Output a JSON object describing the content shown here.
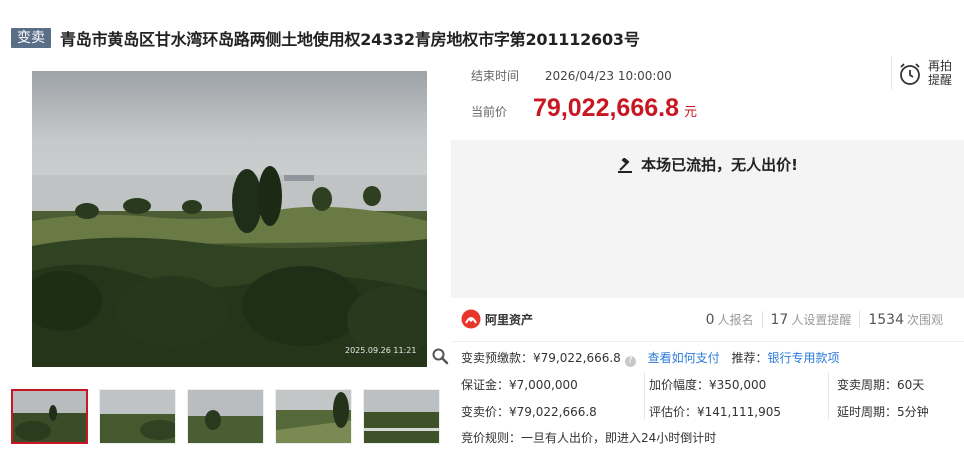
{
  "header": {
    "badge": "变卖",
    "title": "青岛市黄岛区甘水湾环岛路两侧土地使用权24332青房地权市字第201112603号"
  },
  "photo": {
    "timestamp": "2025.09.26 11:21"
  },
  "price": {
    "end_label": "结束时间",
    "end_value": "2026/04/23 10:00:00",
    "remind_label_1": "再拍",
    "remind_label_2": "提醒",
    "current_label": "当前价",
    "current_value": "79,022,666.8",
    "current_unit": "元"
  },
  "status": {
    "text": "本场已流拍，无人出价!"
  },
  "platform": {
    "name": "阿里资产",
    "signups": "0",
    "signups_label": "人报名",
    "reminders": "17",
    "reminders_label": "人设置提醒",
    "views": "1534",
    "views_label": "次围观"
  },
  "info": {
    "deposit_pre_label": "变卖预缴款：",
    "deposit_pre_value": "¥79,022,666.8",
    "how_to_pay": "查看如何支付",
    "recommend_label": "推荐：",
    "bank_loan": "银行专用款项",
    "deposit_label": "保证金：",
    "deposit_value": "¥7,000,000",
    "increment_label": "加价幅度：",
    "increment_value": "¥350,000",
    "cycle_label": "变卖周期：",
    "cycle_value": "60天",
    "sale_price_label": "变卖价：",
    "sale_price_value": "¥79,022,666.8",
    "appraisal_label": "评估价：",
    "appraisal_value": "¥141,111,905",
    "delay_label": "延时周期：",
    "delay_value": "5分钟",
    "rule_label": "竞价规则：",
    "rule_value": "一旦有人出价，即进入24小时倒计时"
  },
  "colors": {
    "accent_red": "#c81623",
    "badge_bg": "#5a6e88",
    "link_blue": "#2d7bd8",
    "status_bg": "#f4f4f4"
  }
}
